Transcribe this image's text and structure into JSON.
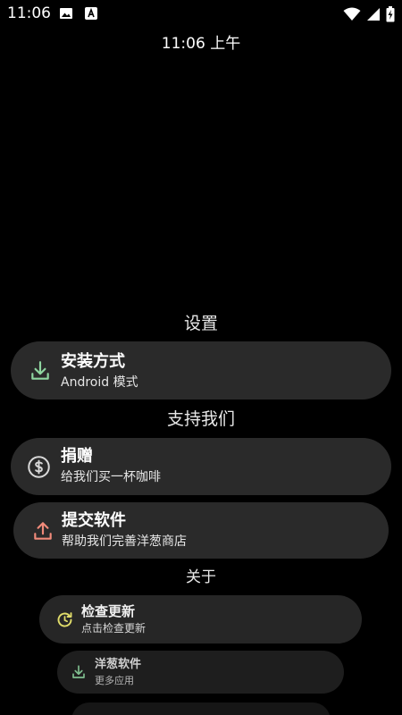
{
  "status_bar": {
    "time": "11:06",
    "left_icons": [
      "image-icon",
      "keyboard-a-icon"
    ],
    "right_icons": [
      "wifi-icon",
      "signal-icon",
      "battery-charging-icon"
    ]
  },
  "clock": {
    "text": "11:06 上午"
  },
  "sections": {
    "settings": "设置",
    "support": "支持我们",
    "about": "关于"
  },
  "items": {
    "install": {
      "title": "安装方式",
      "subtitle": "Android 模式",
      "icon": "download-icon",
      "icon_color": "#8fd6a0"
    },
    "donate": {
      "title": "捐赠",
      "subtitle": "给我们买一杯咖啡",
      "icon": "dollar-circle-icon",
      "icon_color": "#d8d8d8"
    },
    "submit": {
      "title": "提交软件",
      "subtitle": "帮助我们完善洋葱商店",
      "icon": "upload-icon",
      "icon_color": "#f08a7a"
    },
    "update": {
      "title": "检查更新",
      "subtitle": "点击检查更新",
      "icon": "update-clock-icon",
      "icon_color": "#e0dc6a"
    },
    "onion": {
      "title": "洋葱软件",
      "subtitle": "更多应用",
      "icon": "download-icon",
      "icon_color": "#7fbf8f"
    }
  },
  "colors": {
    "background": "#000000",
    "card": "#2a2a2a",
    "text": "#ffffff"
  }
}
